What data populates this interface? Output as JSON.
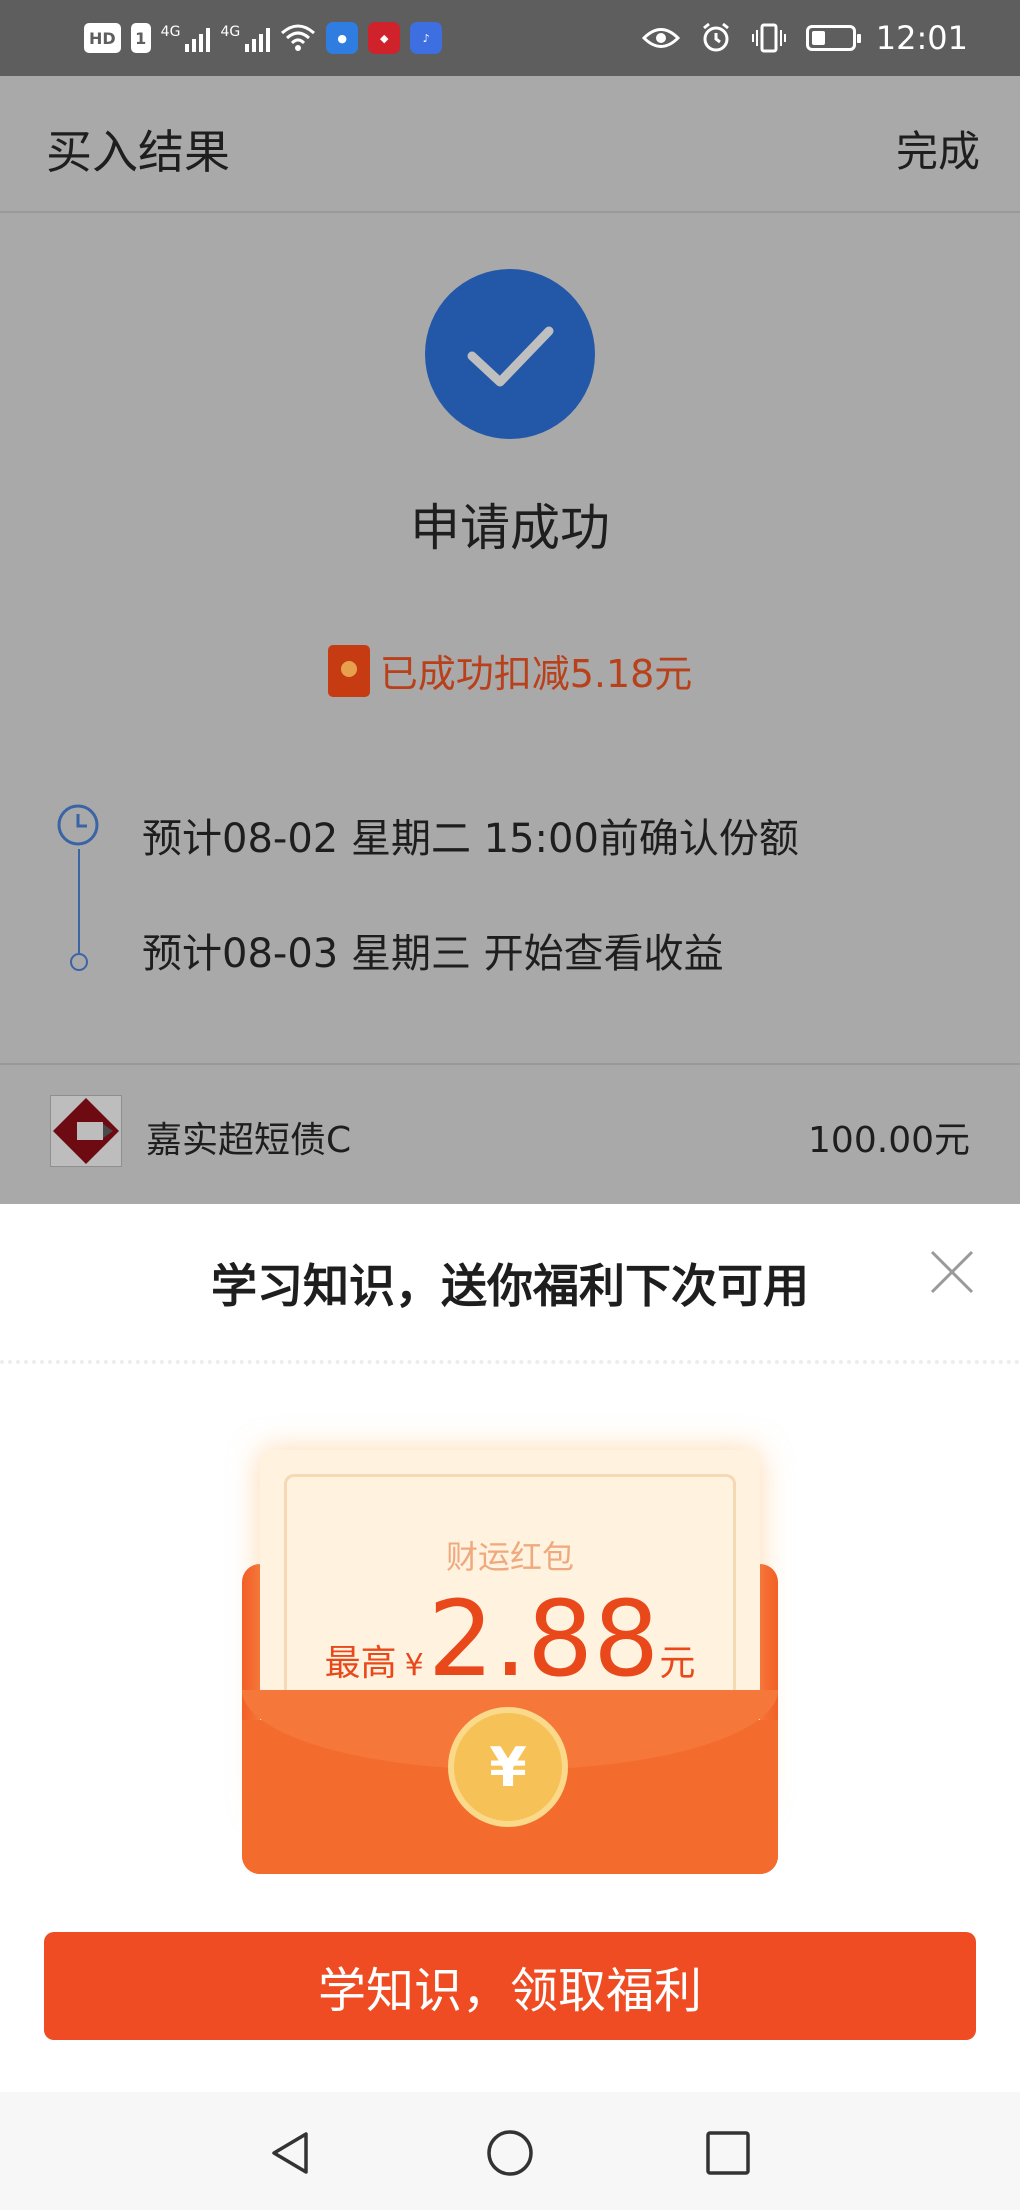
{
  "status_bar": {
    "hd": "HD",
    "sim": "1",
    "signal1": "4G",
    "signal2": "4G",
    "time": "12:01",
    "battery_level": 0.35,
    "icons": [
      "wifi-icon",
      "app-notification-icon",
      "app-notification-icon",
      "music-icon",
      "eye-icon",
      "alarm-icon",
      "vibrate-icon",
      "battery-icon"
    ]
  },
  "header": {
    "title": "买入结果",
    "done_label": "完成"
  },
  "result": {
    "status_title": "申请成功",
    "deduction_text": "已成功扣减5.18元",
    "timeline": [
      "预计08-02 星期二 15:00前确认份额",
      "预计08-03 星期三 开始查看收益"
    ]
  },
  "fund": {
    "name": "嘉实超短债C",
    "amount": "100.00元"
  },
  "sheet": {
    "title": "学习知识，送你福利下次可用",
    "envelope_label": "财运红包",
    "amount_prefix": "最高",
    "currency": "¥",
    "amount_value": "2.88",
    "amount_unit": "元",
    "coin_symbol": "¥",
    "cta_label": "学知识，领取福利"
  },
  "colors": {
    "accent": "#ef4c23",
    "success_blue": "#2358a8",
    "overlay_gray": "#a9a9a9"
  }
}
